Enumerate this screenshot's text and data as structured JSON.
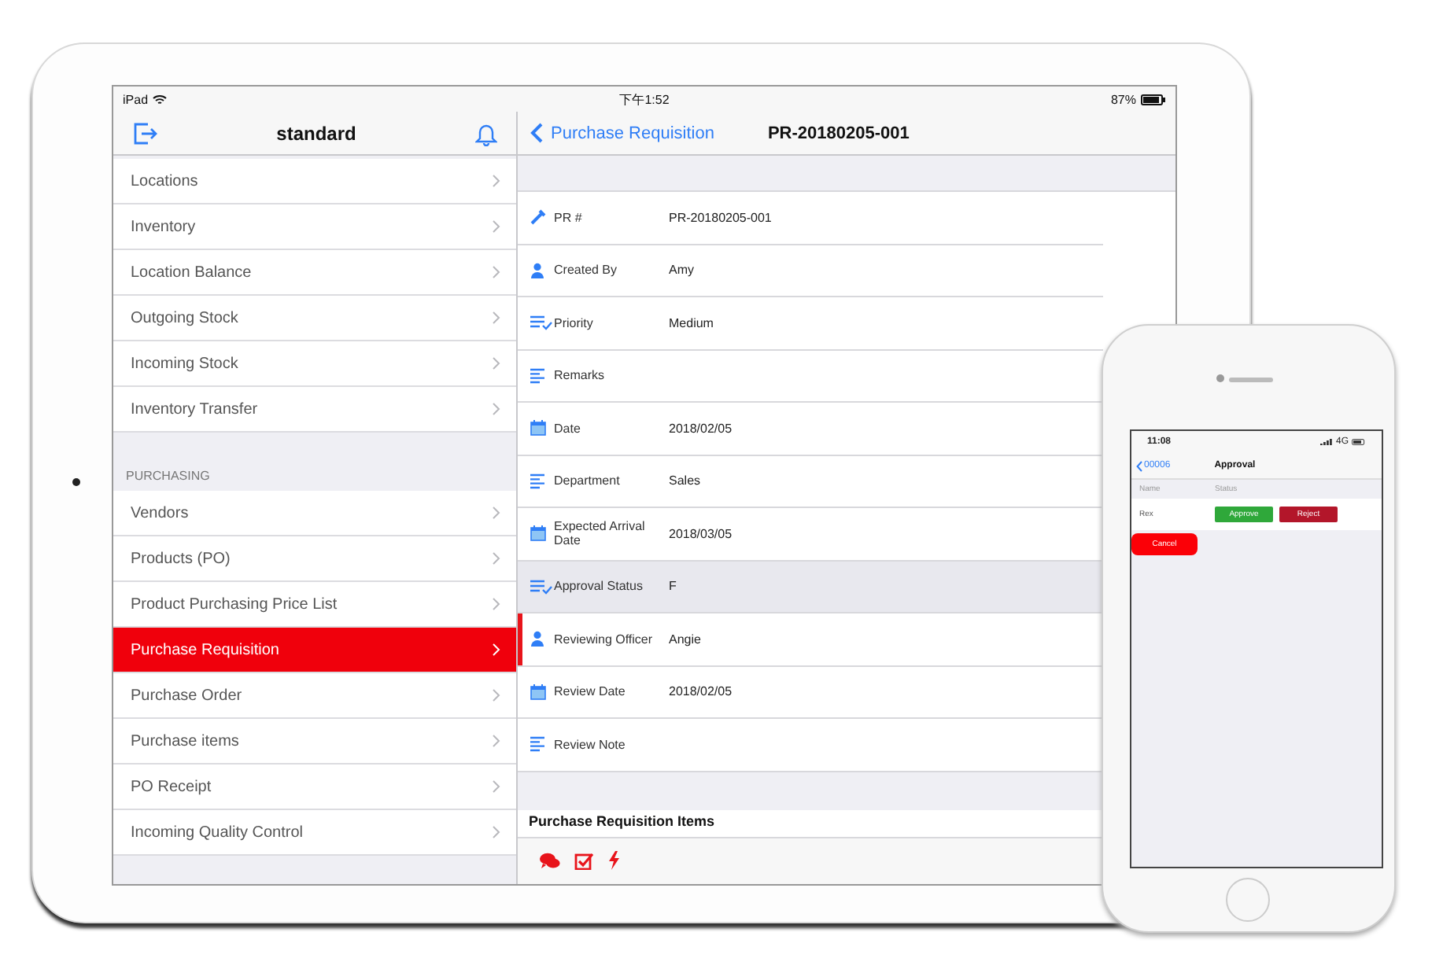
{
  "tablet": {
    "status_bar": {
      "device": "iPad",
      "time": "下午1:52",
      "battery": "87%"
    },
    "sidebar": {
      "title": "standard",
      "groups": [
        {
          "items": [
            {
              "label": "Locations",
              "selected": false
            },
            {
              "label": "Inventory",
              "selected": false
            },
            {
              "label": "Location Balance",
              "selected": false
            },
            {
              "label": "Outgoing Stock",
              "selected": false
            },
            {
              "label": "Incoming Stock",
              "selected": false
            },
            {
              "label": "Inventory Transfer",
              "selected": false
            }
          ]
        },
        {
          "header": "PURCHASING",
          "items": [
            {
              "label": "Vendors",
              "selected": false
            },
            {
              "label": "Products (PO)",
              "selected": false
            },
            {
              "label": "Product Purchasing Price List",
              "selected": false
            },
            {
              "label": "Purchase Requisition",
              "selected": true
            },
            {
              "label": "Purchase Order",
              "selected": false
            },
            {
              "label": "Purchase items",
              "selected": false
            },
            {
              "label": "PO Receipt",
              "selected": false
            },
            {
              "label": "Incoming Quality Control",
              "selected": false
            }
          ]
        }
      ]
    },
    "detail": {
      "back": "Purchase Requisition",
      "title": "PR-20180205-001",
      "fields": [
        {
          "kind": "text",
          "label": "PR #",
          "value": "PR-20180205-001",
          "selected": false,
          "flagged": false
        },
        {
          "kind": "person",
          "label": "Created By",
          "value": "Amy",
          "selected": false,
          "flagged": false
        },
        {
          "kind": "choice",
          "label": "Priority",
          "value": "Medium",
          "selected": false,
          "flagged": false
        },
        {
          "kind": "note",
          "label": "Remarks",
          "selected": false,
          "flagged": false
        },
        {
          "kind": "date",
          "label": "Date",
          "value": "2018/02/05",
          "selected": false,
          "flagged": false
        },
        {
          "kind": "note",
          "label": "Department",
          "value": "Sales",
          "selected": false,
          "flagged": false
        },
        {
          "kind": "date",
          "label": "Expected Arrival Date",
          "value": "2018/03/05",
          "selected": false,
          "flagged": false
        },
        {
          "kind": "choice",
          "label": "Approval Status",
          "value": "F",
          "selected": true,
          "flagged": false
        },
        {
          "kind": "person",
          "label": "Reviewing Officer",
          "value": "Angie",
          "selected": false,
          "flagged": true
        },
        {
          "kind": "date",
          "label": "Review Date",
          "value": "2018/02/05",
          "selected": false,
          "flagged": false
        },
        {
          "kind": "note",
          "label": "Review Note",
          "selected": false,
          "flagged": false
        }
      ],
      "section_title": "Purchase Requisition Items"
    }
  },
  "phone": {
    "status_bar": {
      "time": "11:08",
      "network": "4G"
    },
    "nav": {
      "back": "00006",
      "title": "Approval"
    },
    "columns": [
      "Name",
      "Status"
    ],
    "rows": [
      {
        "name": "Rex",
        "actions": [
          {
            "kind": "approve",
            "label": "Approve"
          },
          {
            "kind": "reject",
            "label": "Reject"
          }
        ]
      }
    ],
    "cancel": "Cancel"
  }
}
